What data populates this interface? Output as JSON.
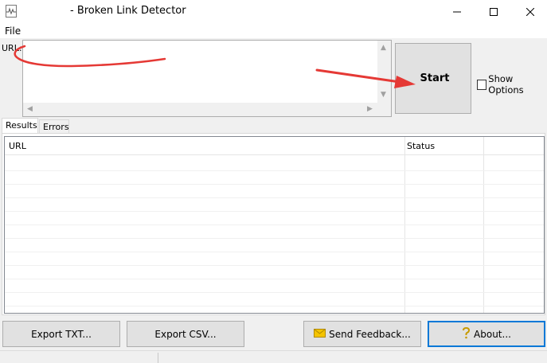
{
  "window": {
    "title": "- Broken Link Detector",
    "icon": "app-icon"
  },
  "menu": {
    "file": "File"
  },
  "url_input": {
    "label": "URL:",
    "value": ""
  },
  "start_button": {
    "label": "Start"
  },
  "show_options": {
    "label": "Show Options",
    "checked": false
  },
  "tabs": [
    {
      "label": "Results",
      "active": true
    },
    {
      "label": "Errors",
      "active": false
    }
  ],
  "results_table": {
    "columns": [
      "URL",
      "Status"
    ],
    "rows": []
  },
  "buttons": {
    "export_txt": "Export TXT...",
    "export_csv": "Export CSV...",
    "send_feedback": "Send Feedback...",
    "about": "About..."
  },
  "colors": {
    "annotation_red": "#e53935",
    "focus_blue": "#0078d7",
    "button_face": "#e1e1e1"
  }
}
